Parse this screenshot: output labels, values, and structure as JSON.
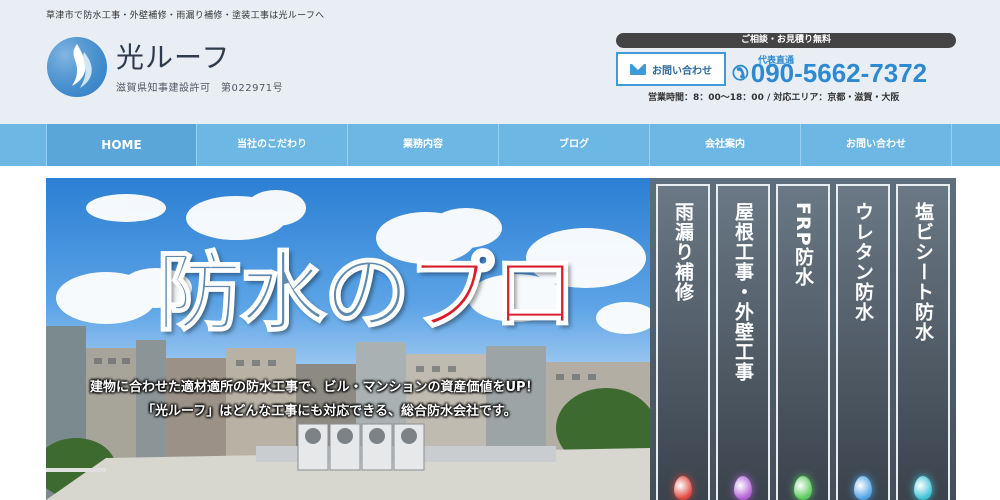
{
  "header": {
    "tagline": "草津市で防水工事・外壁補修・雨漏り補修・塗装工事は光ルーフへ",
    "brand_name": "光ルーフ",
    "license": "滋賀県知事建設許可　第022971号",
    "free_consult": "ご相談・お見積り無料",
    "contact_button": "お問い合わせ",
    "rep_label": "代表直通",
    "phone": "090-5662-7372",
    "hours": "営業時間：8：00～18：00 / 対応エリア：京都・滋賀・大阪"
  },
  "nav": {
    "items": [
      {
        "label": "HOME"
      },
      {
        "label": "当社のこだわり"
      },
      {
        "label": "業務内容"
      },
      {
        "label": "ブログ"
      },
      {
        "label": "会社案内"
      },
      {
        "label": "お問い合わせ"
      }
    ]
  },
  "hero": {
    "title_part1": "防水の",
    "title_part2": "プロ",
    "copy_line1": "建物に合わせた適材適所の防水工事で、ビル・マンションの資産価値をUP！",
    "copy_line2": "「光ルーフ」はどんな工事にも対応できる、総合防水会社です。"
  },
  "services": [
    {
      "label": "雨漏り補修",
      "color": "#e0463c"
    },
    {
      "label": "屋根工事・外壁工事",
      "color": "#b15fd6"
    },
    {
      "label": "FRP防水",
      "color": "#58c95a"
    },
    {
      "label": "ウレタン防水",
      "color": "#4fa3e6"
    },
    {
      "label": "塩ビシート防水",
      "color": "#3ec2d8"
    }
  ],
  "colors": {
    "accent": "#2d8ad0",
    "nav": "#6cb7e4",
    "brand_text": "#2e3b4e"
  }
}
